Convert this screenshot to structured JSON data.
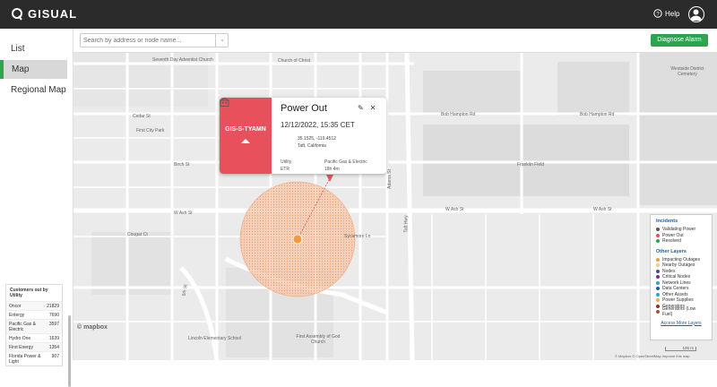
{
  "app": {
    "logo_text": "GISUAL",
    "help_label": "Help"
  },
  "sidebar": {
    "items": [
      {
        "label": "List",
        "active": false
      },
      {
        "label": "Map",
        "active": true
      },
      {
        "label": "Regional Map",
        "active": false
      }
    ]
  },
  "customers": {
    "title": "Customers out by Utility",
    "rows": [
      {
        "name": "Oncor",
        "count": "21829"
      },
      {
        "name": "Entergy",
        "count": "7690"
      },
      {
        "name": "Pacific Gas & Electric",
        "count": "3597"
      },
      {
        "name": "Hydro One",
        "count": "1639"
      },
      {
        "name": "First Energy",
        "count": "1354"
      },
      {
        "name": "Florida Power & Light",
        "count": "907"
      }
    ]
  },
  "toolbar": {
    "search_placeholder": "Search by address or node name...",
    "diagnose_label": "Diagnose Alarm"
  },
  "popup": {
    "node_id": "GIS-S-TYAMN",
    "title": "Power Out",
    "datetime": "12/12/2022, 15:35 CET",
    "coords": "35.1525, -119.4512",
    "location": "Taft, California",
    "utility_label": "Utility",
    "utility_value": "Pacific Gas & Electric",
    "etr_label": "ETR",
    "etr_value": "18h 4m"
  },
  "legend": {
    "incidents_title": "Incidents",
    "incidents": [
      {
        "label": "Validating Power",
        "color": "#555555"
      },
      {
        "label": "Power Out",
        "color": "#e8505b"
      },
      {
        "label": "Resolved",
        "color": "#2ea44f"
      }
    ],
    "layers_title": "Other Layers",
    "layers": [
      {
        "label": "Impacting Outages",
        "color": "#f39a3c"
      },
      {
        "label": "Nearby Outages",
        "color": "#f7c98d"
      },
      {
        "label": "Nodes",
        "color": "#3a4fa0"
      },
      {
        "label": "Critical Nodes",
        "color": "#7a2d8a"
      },
      {
        "label": "Network Lines",
        "color": "#2aa7c9"
      },
      {
        "label": "Data Centers",
        "color": "#1a5fa8"
      },
      {
        "label": "Other Assets",
        "color": "#2aa7c9"
      },
      {
        "label": "Power Supplies",
        "color": "#e8b33a"
      },
      {
        "label": "Generators",
        "color": "#8a2d3a"
      },
      {
        "label": "Generators (Low Fuel)",
        "color": "#a5552d"
      }
    ],
    "more_link": "Access More Layers"
  },
  "map": {
    "streets": {
      "seventh_day": "Seventh Day Adventist Church",
      "church_christ": "Church of Christ",
      "westside": "Westside District Cemetery",
      "bob_hampton": "Bob Hampton Rd",
      "first_city": "First City Park",
      "cedar": "Cedar St",
      "birch": "Birch St",
      "w_ash": "W Ash St",
      "franklin": "Franklin Field",
      "sycamore": "Sycamore Ln",
      "lincoln": "Lincoln Elementary School",
      "first_assembly": "First Assembly of God Church",
      "sixth": "6th St",
      "taft_hwy": "Taft Hwy",
      "adams": "Adams St",
      "cougar": "Cougar Ct"
    },
    "mapbox_label": "© mapbox",
    "attribution": "© Mapbox © OpenStreetMap Improve this map",
    "scale": "100 m"
  }
}
